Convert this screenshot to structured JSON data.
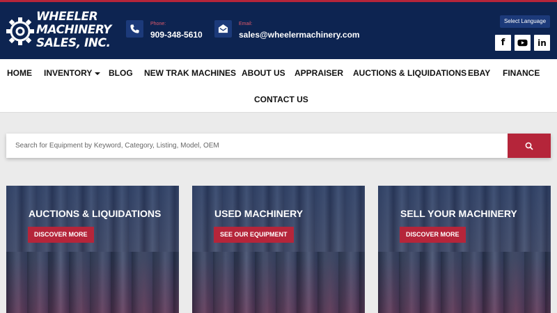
{
  "brand": {
    "logo_lines": [
      "WHEELER",
      "MACHINERY",
      "SALES, INC."
    ]
  },
  "contact": {
    "phone_label": "Phone:",
    "phone": "909-348-5610",
    "email_label": "Email:",
    "email": "sales@wheelermachinery.com"
  },
  "language_button": "Select Language",
  "social": [
    {
      "name": "facebook",
      "glyph": "f"
    },
    {
      "name": "youtube",
      "glyph": ""
    },
    {
      "name": "linkedin",
      "glyph": "in"
    }
  ],
  "nav": {
    "row1": [
      "HOME",
      "INVENTORY",
      "BLOG",
      "NEW TRAK MACHINES",
      "ABOUT US",
      "APPRAISER",
      "AUCTIONS & LIQUIDATIONS",
      "EBAY",
      "FINANCE"
    ],
    "row2": [
      "CONTACT US"
    ]
  },
  "search": {
    "placeholder": "Search for Equipment by Keyword, Category, Listing, Model, OEM"
  },
  "cards": [
    {
      "title": "AUCTIONS &  LIQUIDATIONS",
      "button": "DISCOVER MORE"
    },
    {
      "title": "USED MACHINERY",
      "button": "SEE OUR EQUIPMENT"
    },
    {
      "title": "SELL YOUR MACHINERY",
      "button": "DISCOVER MORE"
    }
  ],
  "colors": {
    "header_bg": "#0d2451",
    "accent_red": "#b5253a",
    "icon_box": "#1c3a7a"
  }
}
